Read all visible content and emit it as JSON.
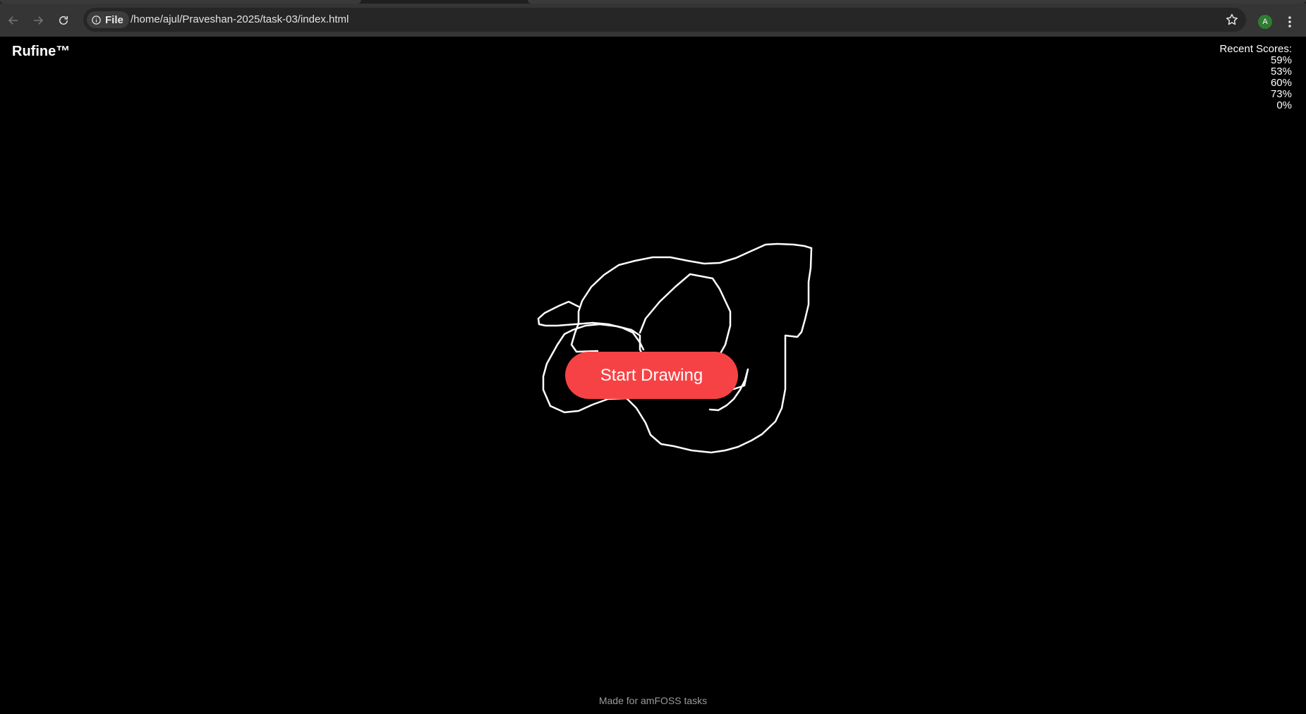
{
  "browser": {
    "chip_label": "File",
    "url": "/home/ajul/Praveshan-2025/task-03/index.html",
    "avatar_initial": "A",
    "icons": [
      "back-arrow-icon",
      "forward-arrow-icon",
      "reload-icon",
      "info-icon",
      "star-icon",
      "kebab-menu-icon"
    ]
  },
  "page": {
    "brand": "Rufine™",
    "scores_title": "Recent Scores:",
    "scores": [
      "59%",
      "53%",
      "60%",
      "73%",
      "0%"
    ],
    "start_button": "Start Drawing",
    "footer": "Made for amFOSS tasks",
    "colors": {
      "background": "#000000",
      "button": "#f74245",
      "stroke": "#ffffff"
    }
  }
}
